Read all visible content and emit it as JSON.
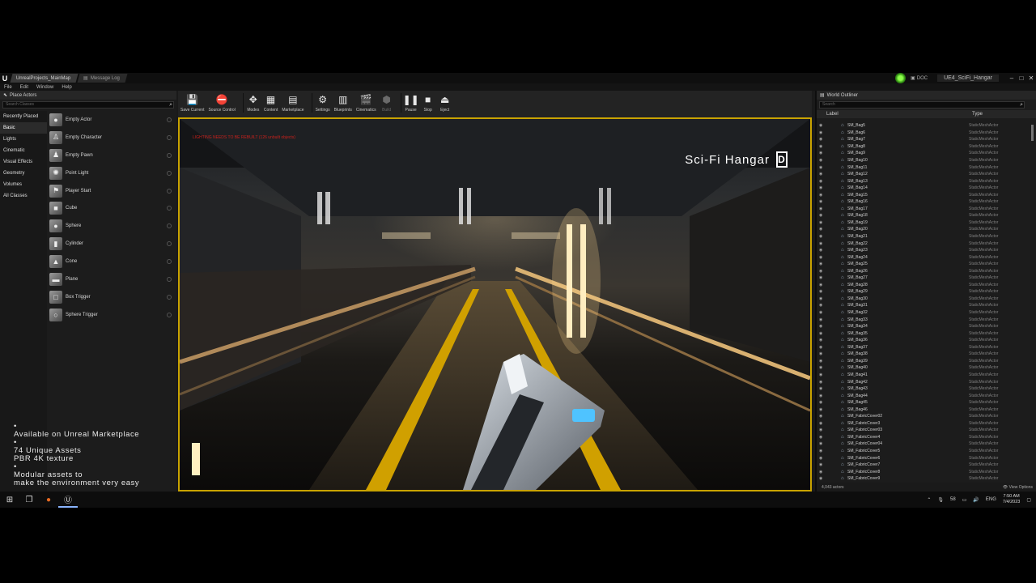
{
  "titlebar": {
    "tabs": [
      {
        "label": "UnrealProjects_MainMap",
        "active": true
      },
      {
        "label": "Message Log",
        "active": false
      }
    ],
    "doc_label": "DOC",
    "project_name": "UE4_SciFi_Hangar",
    "controls": [
      "–",
      "□",
      "✕"
    ]
  },
  "menu": [
    "File",
    "Edit",
    "Window",
    "Help"
  ],
  "place_actors": {
    "tab_label": "Place Actors",
    "search_placeholder": "Search Classes",
    "categories": [
      "Recently Placed",
      "Basic",
      "Lights",
      "Cinematic",
      "Visual Effects",
      "Geometry",
      "Volumes",
      "All Classes"
    ],
    "active_category": "Basic",
    "actors": [
      {
        "name": "Empty Actor",
        "icon": "sphere-icon"
      },
      {
        "name": "Empty Character",
        "icon": "character-icon"
      },
      {
        "name": "Empty Pawn",
        "icon": "pawn-icon"
      },
      {
        "name": "Point Light",
        "icon": "light-icon"
      },
      {
        "name": "Player Start",
        "icon": "player-start-icon"
      },
      {
        "name": "Cube",
        "icon": "cube-icon"
      },
      {
        "name": "Sphere",
        "icon": "sphere-icon"
      },
      {
        "name": "Cylinder",
        "icon": "cylinder-icon"
      },
      {
        "name": "Cone",
        "icon": "cone-icon"
      },
      {
        "name": "Plane",
        "icon": "plane-icon"
      },
      {
        "name": "Box Trigger",
        "icon": "box-trigger-icon"
      },
      {
        "name": "Sphere Trigger",
        "icon": "sphere-trigger-icon"
      }
    ]
  },
  "promo": {
    "lines": [
      "•",
      "Available on Unreal Marketplace",
      "•",
      "74 Unique Assets",
      "PBR 4K texture",
      "•",
      "Modular assets to",
      "make the environment very easy"
    ]
  },
  "toolbar": {
    "buttons": [
      {
        "label": "Save Current",
        "icon": "save-icon",
        "disabled": false,
        "caret": false
      },
      {
        "label": "Source Control",
        "icon": "source-control-icon",
        "disabled": false,
        "caret": true
      },
      {
        "label": "Modes",
        "icon": "modes-icon",
        "disabled": false,
        "caret": true
      },
      {
        "label": "Content",
        "icon": "content-icon",
        "disabled": false,
        "caret": false
      },
      {
        "label": "Marketplace",
        "icon": "marketplace-icon",
        "disabled": false,
        "caret": false
      },
      {
        "label": "Settings",
        "icon": "settings-icon",
        "disabled": false,
        "caret": true
      },
      {
        "label": "Blueprints",
        "icon": "blueprints-icon",
        "disabled": false,
        "caret": true
      },
      {
        "label": "Cinematics",
        "icon": "cinematics-icon",
        "disabled": false,
        "caret": true
      },
      {
        "label": "Build",
        "icon": "build-icon",
        "disabled": true,
        "caret": true
      },
      {
        "label": "Pause",
        "icon": "pause-icon",
        "disabled": false,
        "caret": false
      },
      {
        "label": "Stop",
        "icon": "stop-icon",
        "disabled": false,
        "caret": false
      },
      {
        "label": "Eject",
        "icon": "eject-icon",
        "disabled": false,
        "caret": false
      }
    ]
  },
  "viewport": {
    "stats_text": "LIGHTING NEEDS TO BE REBUILT (126 unbuilt objects)",
    "brand": "Sci-Fi Hangar",
    "brand_badge": "D"
  },
  "outliner": {
    "tab_label": "World Outliner",
    "search_placeholder": "Search",
    "col_label": "Label",
    "col_type": "Type",
    "rows": [
      {
        "name": "SM_Bag5",
        "type": "StaticMeshActor"
      },
      {
        "name": "SM_Bag6",
        "type": "StaticMeshActor"
      },
      {
        "name": "SM_Bag7",
        "type": "StaticMeshActor"
      },
      {
        "name": "SM_Bag8",
        "type": "StaticMeshActor"
      },
      {
        "name": "SM_Bag9",
        "type": "StaticMeshActor"
      },
      {
        "name": "SM_Bag10",
        "type": "StaticMeshActor"
      },
      {
        "name": "SM_Bag11",
        "type": "StaticMeshActor"
      },
      {
        "name": "SM_Bag12",
        "type": "StaticMeshActor"
      },
      {
        "name": "SM_Bag13",
        "type": "StaticMeshActor"
      },
      {
        "name": "SM_Bag14",
        "type": "StaticMeshActor"
      },
      {
        "name": "SM_Bag15",
        "type": "StaticMeshActor"
      },
      {
        "name": "SM_Bag16",
        "type": "StaticMeshActor"
      },
      {
        "name": "SM_Bag17",
        "type": "StaticMeshActor"
      },
      {
        "name": "SM_Bag18",
        "type": "StaticMeshActor"
      },
      {
        "name": "SM_Bag19",
        "type": "StaticMeshActor"
      },
      {
        "name": "SM_Bag20",
        "type": "StaticMeshActor"
      },
      {
        "name": "SM_Bag21",
        "type": "StaticMeshActor"
      },
      {
        "name": "SM_Bag22",
        "type": "StaticMeshActor"
      },
      {
        "name": "SM_Bag23",
        "type": "StaticMeshActor"
      },
      {
        "name": "SM_Bag24",
        "type": "StaticMeshActor"
      },
      {
        "name": "SM_Bag25",
        "type": "StaticMeshActor"
      },
      {
        "name": "SM_Bag26",
        "type": "StaticMeshActor"
      },
      {
        "name": "SM_Bag27",
        "type": "StaticMeshActor"
      },
      {
        "name": "SM_Bag28",
        "type": "StaticMeshActor"
      },
      {
        "name": "SM_Bag29",
        "type": "StaticMeshActor"
      },
      {
        "name": "SM_Bag30",
        "type": "StaticMeshActor"
      },
      {
        "name": "SM_Bag31",
        "type": "StaticMeshActor"
      },
      {
        "name": "SM_Bag32",
        "type": "StaticMeshActor"
      },
      {
        "name": "SM_Bag33",
        "type": "StaticMeshActor"
      },
      {
        "name": "SM_Bag34",
        "type": "StaticMeshActor"
      },
      {
        "name": "SM_Bag35",
        "type": "StaticMeshActor"
      },
      {
        "name": "SM_Bag36",
        "type": "StaticMeshActor"
      },
      {
        "name": "SM_Bag37",
        "type": "StaticMeshActor"
      },
      {
        "name": "SM_Bag38",
        "type": "StaticMeshActor"
      },
      {
        "name": "SM_Bag39",
        "type": "StaticMeshActor"
      },
      {
        "name": "SM_Bag40",
        "type": "StaticMeshActor"
      },
      {
        "name": "SM_Bag41",
        "type": "StaticMeshActor"
      },
      {
        "name": "SM_Bag42",
        "type": "StaticMeshActor"
      },
      {
        "name": "SM_Bag43",
        "type": "StaticMeshActor"
      },
      {
        "name": "SM_Bag44",
        "type": "StaticMeshActor"
      },
      {
        "name": "SM_Bag45",
        "type": "StaticMeshActor"
      },
      {
        "name": "SM_Bag46",
        "type": "StaticMeshActor"
      },
      {
        "name": "SM_FabricCover02",
        "type": "StaticMeshActor"
      },
      {
        "name": "SM_FabricCover3",
        "type": "StaticMeshActor"
      },
      {
        "name": "SM_FabricCover03",
        "type": "StaticMeshActor"
      },
      {
        "name": "SM_FabricCover4",
        "type": "StaticMeshActor"
      },
      {
        "name": "SM_FabricCover04",
        "type": "StaticMeshActor"
      },
      {
        "name": "SM_FabricCover5",
        "type": "StaticMeshActor"
      },
      {
        "name": "SM_FabricCover6",
        "type": "StaticMeshActor"
      },
      {
        "name": "SM_FabricCover7",
        "type": "StaticMeshActor"
      },
      {
        "name": "SM_FabricCover8",
        "type": "StaticMeshActor"
      },
      {
        "name": "SM_FabricCover9",
        "type": "StaticMeshActor"
      }
    ],
    "actor_count": "4,043 actors",
    "view_options": "View Options"
  },
  "taskbar": {
    "tray_temp": "58",
    "language": "ENG",
    "time": "7:50 AM",
    "date": "7/4/2023"
  },
  "colors": {
    "viewport_border": "#c9a300",
    "stats_red": "#c8201c"
  }
}
